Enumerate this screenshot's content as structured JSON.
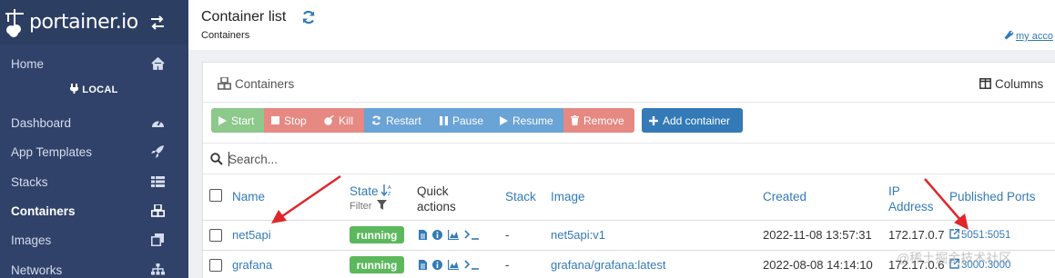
{
  "brand": {
    "name": "portainer.io"
  },
  "sidebar": {
    "endpoint": "LOCAL",
    "items": [
      {
        "label": "Home",
        "icon": "home-icon"
      },
      {
        "label": "Dashboard",
        "icon": "tachometer-icon"
      },
      {
        "label": "App Templates",
        "icon": "rocket-icon"
      },
      {
        "label": "Stacks",
        "icon": "th-list-icon"
      },
      {
        "label": "Containers",
        "icon": "cubes-icon",
        "active": true
      },
      {
        "label": "Images",
        "icon": "clone-icon"
      },
      {
        "label": "Networks",
        "icon": "sitemap-icon"
      }
    ]
  },
  "header": {
    "title": "Container list",
    "breadcrumb": "Containers",
    "account_link": "my acco"
  },
  "panel": {
    "title": "Containers",
    "columns_label": "Columns"
  },
  "actions": {
    "start": "Start",
    "stop": "Stop",
    "kill": "Kill",
    "restart": "Restart",
    "pause": "Pause",
    "resume": "Resume",
    "remove": "Remove",
    "add": "Add container"
  },
  "search": {
    "placeholder": "Search..."
  },
  "table": {
    "headers": {
      "name": "Name",
      "state": "State",
      "state_filter": "Filter",
      "quick_actions_1": "Quick",
      "quick_actions_2": "actions",
      "stack": "Stack",
      "image": "Image",
      "created": "Created",
      "ip_1": "IP",
      "ip_2": "Address",
      "ports": "Published Ports"
    },
    "rows": [
      {
        "name": "net5api",
        "state": "running",
        "stack": "-",
        "image": "net5api:v1",
        "created": "2022-11-08 13:57:31",
        "ip": "172.17.0.7",
        "ports": "5051:5051"
      },
      {
        "name": "grafana",
        "state": "running",
        "stack": "-",
        "image": "grafana/grafana:latest",
        "created": "2022-08-08 14:14:10",
        "ip": "172.17.0.6",
        "ports": "3000:3000"
      }
    ]
  },
  "watermark": "@稀土掘金技术社区",
  "colors": {
    "sidebar": "#30426a",
    "primary": "#337ab7",
    "success": "#5cb85c",
    "danger": "#e68983",
    "annotation": "#e0262a"
  }
}
